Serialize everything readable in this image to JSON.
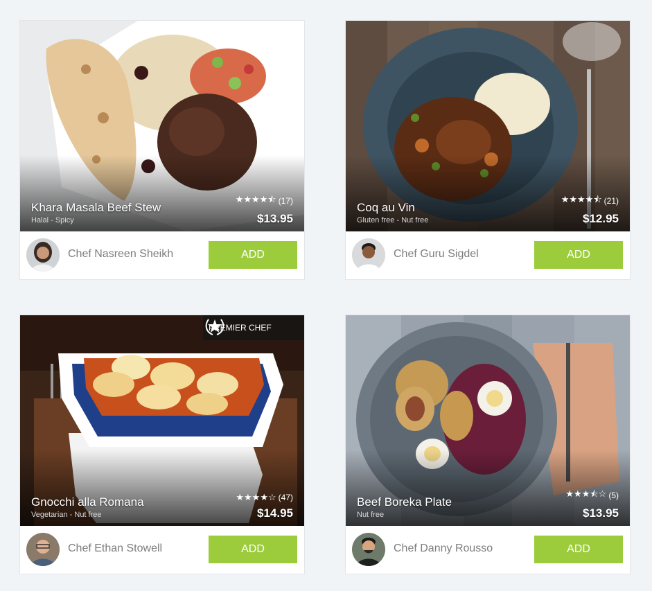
{
  "button_label": "ADD",
  "colors": {
    "accent": "#9ccc3c",
    "background": "#f1f4f6"
  },
  "cards": [
    {
      "dish_name": "Khara Masala Beef Stew",
      "tags": "Halal - Spicy",
      "stars": "★★★★⯪",
      "review_count": "(17)",
      "rating_value": 4.5,
      "price": "$13.95",
      "chef_name": "Chef Nasreen Sheikh",
      "badge": ""
    },
    {
      "dish_name": "Coq au Vin",
      "tags": "Gluten free - Nut free",
      "stars": "★★★★⯪",
      "review_count": "(21)",
      "rating_value": 4.5,
      "price": "$12.95",
      "chef_name": "Chef Guru Sigdel",
      "badge": ""
    },
    {
      "dish_name": "Gnocchi alla Romana",
      "tags": "Vegetarian - Nut free",
      "stars": "★★★★☆",
      "review_count": "(47)",
      "rating_value": 4,
      "price": "$14.95",
      "chef_name": "Chef Ethan Stowell",
      "badge": "PREMIER CHEF"
    },
    {
      "dish_name": "Beef Boreka Plate",
      "tags": "Nut free",
      "stars": "★★★⯪☆",
      "review_count": "(5)",
      "rating_value": 3.5,
      "price": "$13.95",
      "chef_name": "Chef Danny Rousso",
      "badge": ""
    }
  ]
}
